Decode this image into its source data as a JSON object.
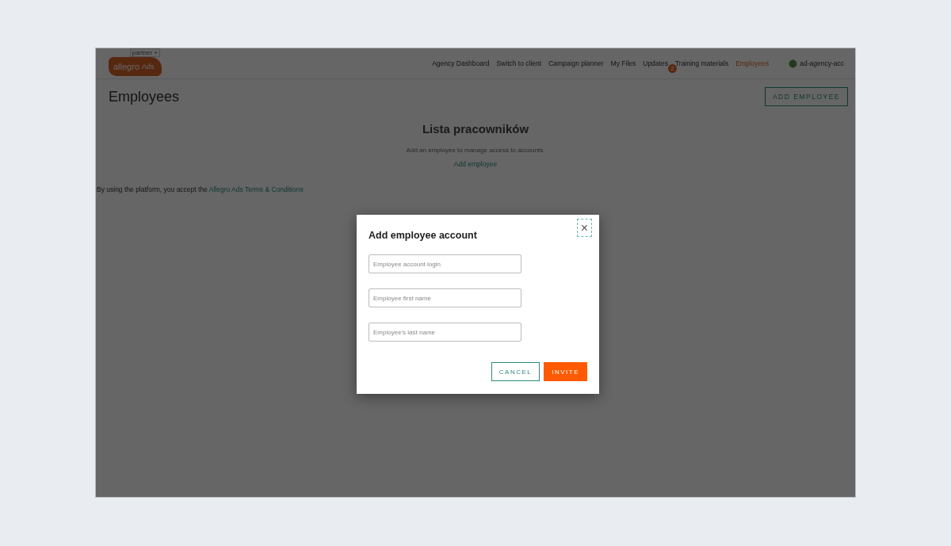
{
  "logo": {
    "brand": "allegro",
    "product": "Ads",
    "tag": "partner +"
  },
  "nav": [
    {
      "label": "Agency Dashboard",
      "selected": false
    },
    {
      "label": "Switch to client",
      "selected": false
    },
    {
      "label": "Campaign planner",
      "selected": false
    },
    {
      "label": "My Files",
      "selected": false
    },
    {
      "label": "Updates",
      "selected": false,
      "badge": "2"
    },
    {
      "label": "Training materials",
      "selected": false
    },
    {
      "label": "Employees",
      "selected": true
    }
  ],
  "account": "ad-agency-acc",
  "page": {
    "title": "Employees",
    "add_button": "ADD EMPLOYEE"
  },
  "empty_state": {
    "heading": "Lista pracowników",
    "text": "Add an employee to manage access to accounts.",
    "link": "Add employee"
  },
  "terms": {
    "text": "By using the platform, you accept the ",
    "link": "Allegro Ads Terms & Conditions"
  },
  "modal": {
    "title": "Add employee account",
    "close": "×",
    "fields": [
      {
        "placeholder": "Employee account login"
      },
      {
        "placeholder": "Employee first name"
      },
      {
        "placeholder": "Employee's last name"
      }
    ],
    "cancel": "CANCEL",
    "invite": "INVITE"
  }
}
